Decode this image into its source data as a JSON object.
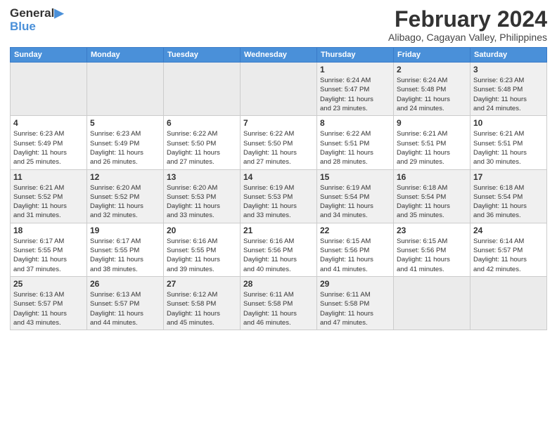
{
  "logo": {
    "text_general": "General",
    "text_blue": "Blue"
  },
  "title": {
    "month_year": "February 2024",
    "location": "Alibago, Cagayan Valley, Philippines"
  },
  "weekdays": [
    "Sunday",
    "Monday",
    "Tuesday",
    "Wednesday",
    "Thursday",
    "Friday",
    "Saturday"
  ],
  "weeks": [
    [
      {
        "day": "",
        "detail": ""
      },
      {
        "day": "",
        "detail": ""
      },
      {
        "day": "",
        "detail": ""
      },
      {
        "day": "",
        "detail": ""
      },
      {
        "day": "1",
        "detail": "Sunrise: 6:24 AM\nSunset: 5:47 PM\nDaylight: 11 hours\nand 23 minutes."
      },
      {
        "day": "2",
        "detail": "Sunrise: 6:24 AM\nSunset: 5:48 PM\nDaylight: 11 hours\nand 24 minutes."
      },
      {
        "day": "3",
        "detail": "Sunrise: 6:23 AM\nSunset: 5:48 PM\nDaylight: 11 hours\nand 24 minutes."
      }
    ],
    [
      {
        "day": "4",
        "detail": "Sunrise: 6:23 AM\nSunset: 5:49 PM\nDaylight: 11 hours\nand 25 minutes."
      },
      {
        "day": "5",
        "detail": "Sunrise: 6:23 AM\nSunset: 5:49 PM\nDaylight: 11 hours\nand 26 minutes."
      },
      {
        "day": "6",
        "detail": "Sunrise: 6:22 AM\nSunset: 5:50 PM\nDaylight: 11 hours\nand 27 minutes."
      },
      {
        "day": "7",
        "detail": "Sunrise: 6:22 AM\nSunset: 5:50 PM\nDaylight: 11 hours\nand 27 minutes."
      },
      {
        "day": "8",
        "detail": "Sunrise: 6:22 AM\nSunset: 5:51 PM\nDaylight: 11 hours\nand 28 minutes."
      },
      {
        "day": "9",
        "detail": "Sunrise: 6:21 AM\nSunset: 5:51 PM\nDaylight: 11 hours\nand 29 minutes."
      },
      {
        "day": "10",
        "detail": "Sunrise: 6:21 AM\nSunset: 5:51 PM\nDaylight: 11 hours\nand 30 minutes."
      }
    ],
    [
      {
        "day": "11",
        "detail": "Sunrise: 6:21 AM\nSunset: 5:52 PM\nDaylight: 11 hours\nand 31 minutes."
      },
      {
        "day": "12",
        "detail": "Sunrise: 6:20 AM\nSunset: 5:52 PM\nDaylight: 11 hours\nand 32 minutes."
      },
      {
        "day": "13",
        "detail": "Sunrise: 6:20 AM\nSunset: 5:53 PM\nDaylight: 11 hours\nand 33 minutes."
      },
      {
        "day": "14",
        "detail": "Sunrise: 6:19 AM\nSunset: 5:53 PM\nDaylight: 11 hours\nand 33 minutes."
      },
      {
        "day": "15",
        "detail": "Sunrise: 6:19 AM\nSunset: 5:54 PM\nDaylight: 11 hours\nand 34 minutes."
      },
      {
        "day": "16",
        "detail": "Sunrise: 6:18 AM\nSunset: 5:54 PM\nDaylight: 11 hours\nand 35 minutes."
      },
      {
        "day": "17",
        "detail": "Sunrise: 6:18 AM\nSunset: 5:54 PM\nDaylight: 11 hours\nand 36 minutes."
      }
    ],
    [
      {
        "day": "18",
        "detail": "Sunrise: 6:17 AM\nSunset: 5:55 PM\nDaylight: 11 hours\nand 37 minutes."
      },
      {
        "day": "19",
        "detail": "Sunrise: 6:17 AM\nSunset: 5:55 PM\nDaylight: 11 hours\nand 38 minutes."
      },
      {
        "day": "20",
        "detail": "Sunrise: 6:16 AM\nSunset: 5:55 PM\nDaylight: 11 hours\nand 39 minutes."
      },
      {
        "day": "21",
        "detail": "Sunrise: 6:16 AM\nSunset: 5:56 PM\nDaylight: 11 hours\nand 40 minutes."
      },
      {
        "day": "22",
        "detail": "Sunrise: 6:15 AM\nSunset: 5:56 PM\nDaylight: 11 hours\nand 41 minutes."
      },
      {
        "day": "23",
        "detail": "Sunrise: 6:15 AM\nSunset: 5:56 PM\nDaylight: 11 hours\nand 41 minutes."
      },
      {
        "day": "24",
        "detail": "Sunrise: 6:14 AM\nSunset: 5:57 PM\nDaylight: 11 hours\nand 42 minutes."
      }
    ],
    [
      {
        "day": "25",
        "detail": "Sunrise: 6:13 AM\nSunset: 5:57 PM\nDaylight: 11 hours\nand 43 minutes."
      },
      {
        "day": "26",
        "detail": "Sunrise: 6:13 AM\nSunset: 5:57 PM\nDaylight: 11 hours\nand 44 minutes."
      },
      {
        "day": "27",
        "detail": "Sunrise: 6:12 AM\nSunset: 5:58 PM\nDaylight: 11 hours\nand 45 minutes."
      },
      {
        "day": "28",
        "detail": "Sunrise: 6:11 AM\nSunset: 5:58 PM\nDaylight: 11 hours\nand 46 minutes."
      },
      {
        "day": "29",
        "detail": "Sunrise: 6:11 AM\nSunset: 5:58 PM\nDaylight: 11 hours\nand 47 minutes."
      },
      {
        "day": "",
        "detail": ""
      },
      {
        "day": "",
        "detail": ""
      }
    ]
  ]
}
